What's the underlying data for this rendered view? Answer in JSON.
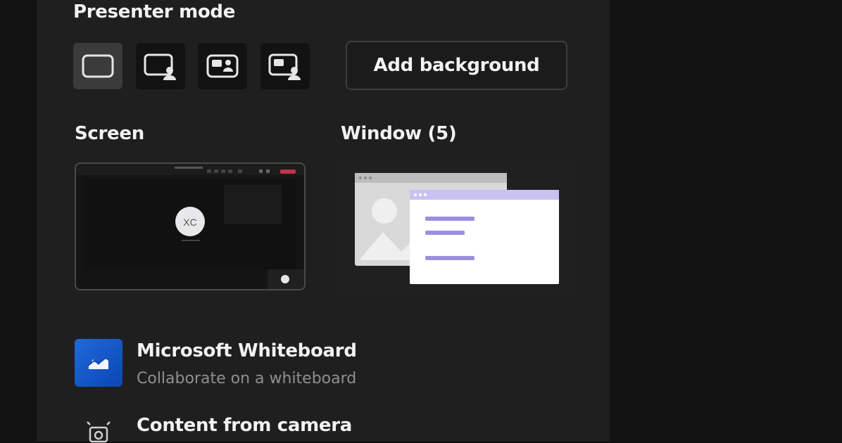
{
  "presenter_mode": {
    "title": "Presenter mode",
    "modes": [
      {
        "icon": "content-only-icon",
        "selected": true
      },
      {
        "icon": "standout-icon",
        "selected": false
      },
      {
        "icon": "side-by-side-icon",
        "selected": false
      },
      {
        "icon": "reporter-icon",
        "selected": false
      }
    ],
    "add_background_label": "Add background"
  },
  "screen": {
    "title": "Screen"
  },
  "window": {
    "title": "Window (5)"
  },
  "items": [
    {
      "title": "Microsoft Whiteboard",
      "subtitle": "Collaborate on a whiteboard",
      "icon": "whiteboard-icon"
    },
    {
      "title": "Content from camera",
      "icon": "camera-icon"
    }
  ],
  "colors": {
    "panel_bg": "#1f1f1f",
    "selected_mode_bg": "#3b3b3b",
    "whiteboard_blue": "#1f6bd6",
    "window_accent": "#9d8fe0"
  }
}
